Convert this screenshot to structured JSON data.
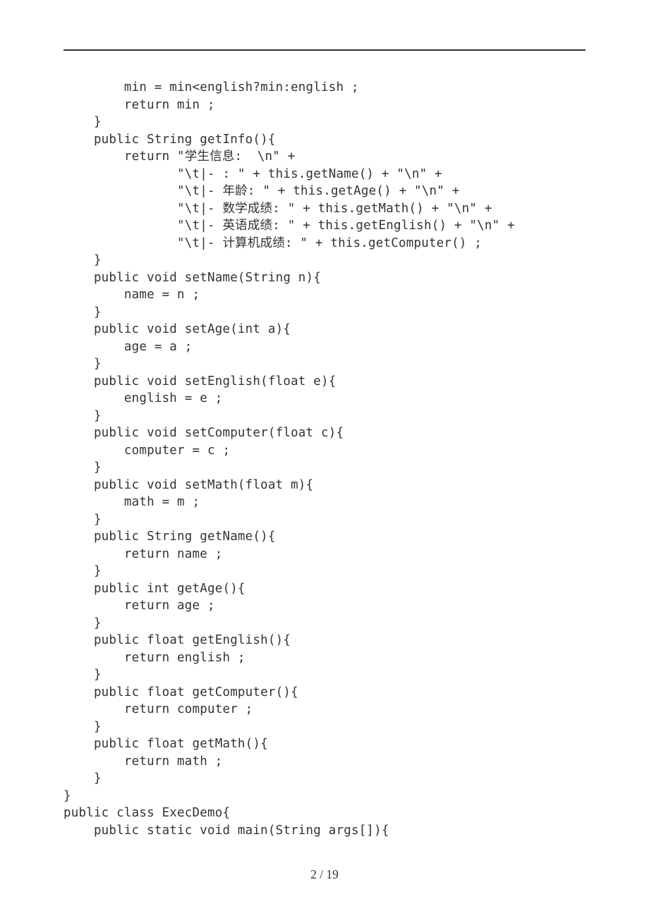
{
  "page_number": "2 / 19",
  "code": "        min = min<english?min:english ;\n        return min ;\n    }\n    public String getInfo(){\n        return \"学生信息:  \\n\" +\n               \"\\t|- : \" + this.getName() + \"\\n\" +\n               \"\\t|- 年龄: \" + this.getAge() + \"\\n\" +\n               \"\\t|- 数学成绩: \" + this.getMath() + \"\\n\" +\n               \"\\t|- 英语成绩: \" + this.getEnglish() + \"\\n\" +\n               \"\\t|- 计算机成绩: \" + this.getComputer() ;\n    }\n    public void setName(String n){\n        name = n ;\n    }\n    public void setAge(int a){\n        age = a ;\n    }\n    public void setEnglish(float e){\n        english = e ;\n    }\n    public void setComputer(float c){\n        computer = c ;\n    }\n    public void setMath(float m){\n        math = m ;\n    }\n    public String getName(){\n        return name ;\n    }\n    public int getAge(){\n        return age ;\n    }\n    public float getEnglish(){\n        return english ;\n    }\n    public float getComputer(){\n        return computer ;\n    }\n    public float getMath(){\n        return math ;\n    }\n}\npublic class ExecDemo{\n    public static void main(String args[]){"
}
